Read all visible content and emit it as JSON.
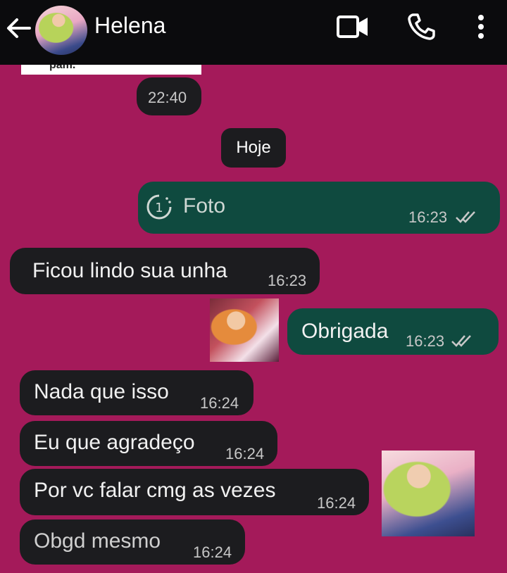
{
  "header": {
    "contact_name": "Helena",
    "icons": [
      "back-arrow-icon",
      "avatar",
      "video-call-icon",
      "phone-icon",
      "more-options-icon"
    ]
  },
  "clipped_text": "pam.",
  "messages": [
    {
      "id": "m0",
      "side": "received",
      "text": "",
      "time": "22:40"
    },
    {
      "id": "date",
      "type": "date",
      "text": "Hoje"
    },
    {
      "id": "m1",
      "side": "sent",
      "text": "Foto",
      "time": "16:23",
      "status": "read"
    },
    {
      "id": "m2",
      "side": "received",
      "text": "Ficou lindo sua unha",
      "time": "16:23"
    },
    {
      "id": "m3",
      "side": "sent",
      "text": "Obrigada",
      "time": "16:23",
      "status": "read"
    },
    {
      "id": "m4",
      "side": "received",
      "text": "Nada que isso",
      "time": "16:24"
    },
    {
      "id": "m5",
      "side": "received",
      "text": "Eu que agradeço",
      "time": "16:24"
    },
    {
      "id": "m6",
      "side": "received",
      "text": "Por vc falar cmg as vezes",
      "time": "16:24"
    },
    {
      "id": "m7",
      "side": "received",
      "text": "Obgd mesmo",
      "time": "16:24"
    }
  ],
  "colors": {
    "background": "#a41a5a",
    "topbar": "#0b0b0d",
    "received_bubble": "#1c1c1f",
    "sent_bubble": "#0f4a3f",
    "read_ticks": "#c8c8c8"
  }
}
